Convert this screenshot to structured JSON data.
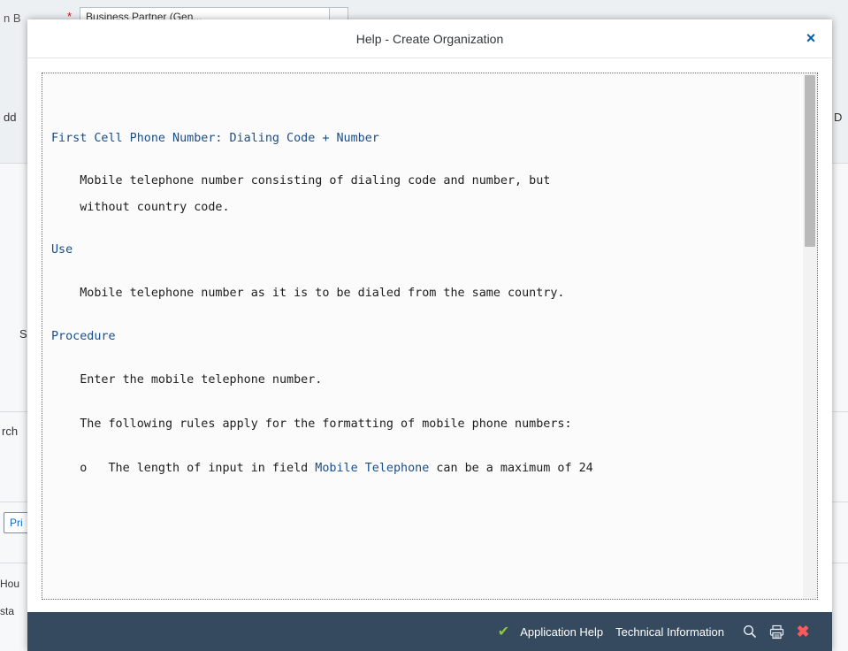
{
  "background": {
    "field_label_fragment": "n B",
    "required_mark": "*",
    "field_value_fragment": "Business Partner (Gen...",
    "left_fragments": [
      "dd",
      "S",
      "rch",
      "Hou",
      "sta"
    ],
    "right_fragment": "D",
    "button_fragment": "Pri"
  },
  "dialog": {
    "title": "Help - Create Organization",
    "close_glyph": "×"
  },
  "help": {
    "heading": "First Cell Phone Number: Dialing Code + Number",
    "definition_line1": "    Mobile telephone number consisting of dialing code and number, but",
    "definition_line2": "    without country code.",
    "use_heading": "Use",
    "use_text": "    Mobile telephone number as it is to be dialed from the same country.",
    "procedure_heading": "Procedure",
    "procedure_text": "    Enter the mobile telephone number.",
    "rules_text": "    The following rules apply for the formatting of mobile phone numbers:",
    "bullet_prefix": "    o   The length of input in field ",
    "bullet_link": "Mobile Telephone",
    "bullet_suffix": " can be a maximum of 24"
  },
  "footer": {
    "check_glyph": "✔",
    "application_help": "Application Help",
    "technical_information": "Technical Information",
    "icons": [
      "search-icon",
      "print-icon",
      "close-icon"
    ],
    "close_glyph": "✖"
  },
  "colors": {
    "footer_bg": "#354a5f",
    "link_blue": "#1a4e8a",
    "check_green": "#8fc63f",
    "close_red": "#ff5a5a"
  }
}
